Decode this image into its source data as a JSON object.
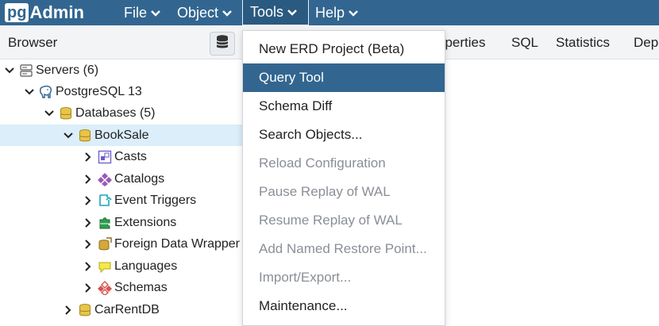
{
  "navbar": {
    "logo_pg": "pg",
    "logo_admin": "Admin",
    "menus": [
      {
        "label": "File"
      },
      {
        "label": "Object"
      },
      {
        "label": "Tools"
      },
      {
        "label": "Help"
      }
    ],
    "bg_color": "#326690"
  },
  "browser": {
    "title": "Browser",
    "tree": [
      {
        "label": "Servers (6)",
        "icon": "servers-icon"
      },
      {
        "label": "PostgreSQL 13",
        "icon": "postgresql-elephant-icon"
      },
      {
        "label": "Databases (5)",
        "icon": "databases-icon"
      },
      {
        "label": "BookSale",
        "icon": "database-icon",
        "selected": true
      },
      {
        "label": "Casts",
        "icon": "casts-icon"
      },
      {
        "label": "Catalogs",
        "icon": "catalogs-icon"
      },
      {
        "label": "Event Triggers",
        "icon": "event-triggers-icon"
      },
      {
        "label": "Extensions",
        "icon": "extensions-icon"
      },
      {
        "label": "Foreign Data Wrapper",
        "icon": "foreign-data-wrapper-icon"
      },
      {
        "label": "Languages",
        "icon": "languages-icon"
      },
      {
        "label": "Schemas",
        "icon": "schemas-icon"
      },
      {
        "label": "CarRentDB",
        "icon": "database-icon"
      }
    ]
  },
  "tabs": [
    {
      "label": "operties"
    },
    {
      "label": "SQL"
    },
    {
      "label": "Statistics"
    },
    {
      "label": "Depe"
    }
  ],
  "tools_menu": {
    "items": [
      {
        "label": "New ERD Project (Beta)",
        "state": "enabled"
      },
      {
        "label": "Query Tool",
        "state": "highlighted"
      },
      {
        "label": "Schema Diff",
        "state": "enabled"
      },
      {
        "label": "Search Objects...",
        "state": "enabled"
      },
      {
        "label": "Reload Configuration",
        "state": "disabled"
      },
      {
        "label": "Pause Replay of WAL",
        "state": "disabled"
      },
      {
        "label": "Resume Replay of WAL",
        "state": "disabled"
      },
      {
        "label": "Add Named Restore Point...",
        "state": "disabled"
      },
      {
        "label": "Import/Export...",
        "state": "disabled"
      },
      {
        "label": "Maintenance...",
        "state": "enabled"
      }
    ]
  }
}
